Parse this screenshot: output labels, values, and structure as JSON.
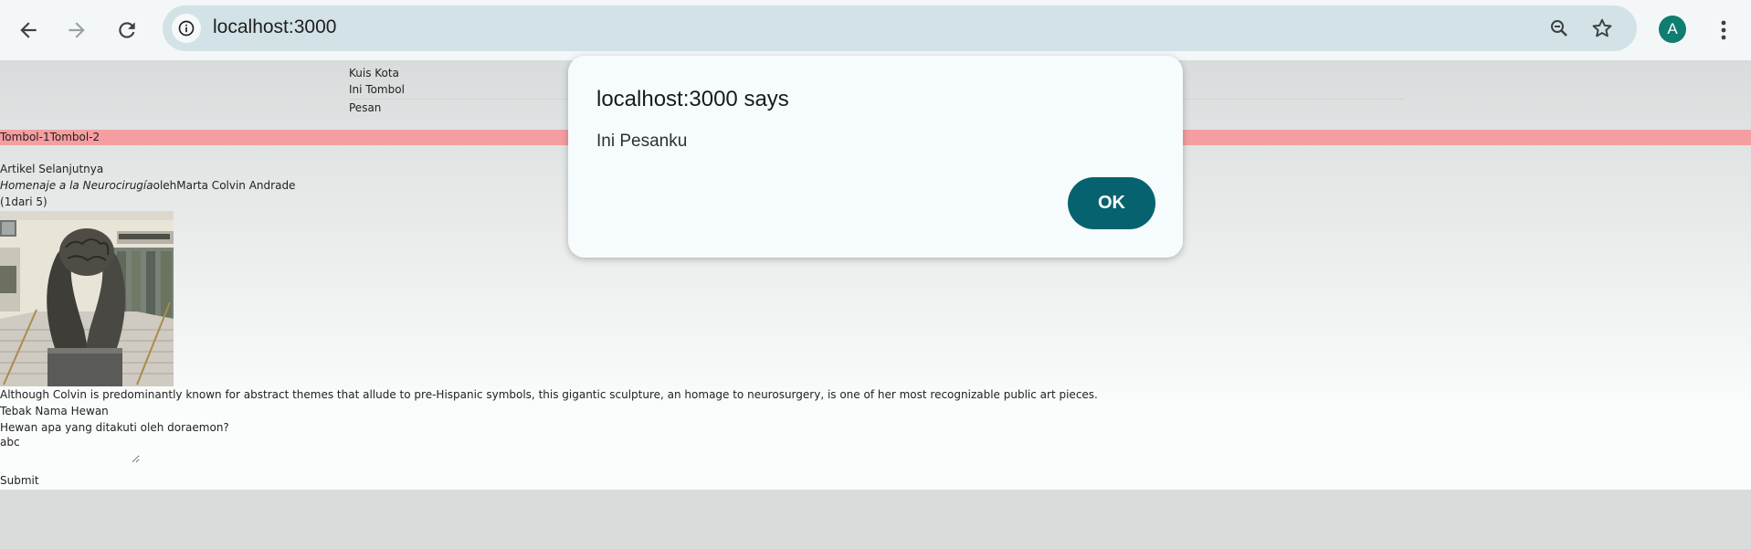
{
  "browser": {
    "url": "localhost:3000",
    "avatar_letter": "A",
    "icons": {
      "back": "arrow-left-icon",
      "forward": "arrow-right-icon",
      "reload": "reload-icon",
      "site_info": "info-icon",
      "zoom": "zoom-out-icon",
      "bookmark": "star-icon",
      "menu": "kebab-menu-icon"
    }
  },
  "page": {
    "nav": [
      "Kuis Kota",
      "Ini Tombol",
      "Pesan"
    ],
    "buttons": {
      "first": "Tombol-1",
      "second": "Tombol-2",
      "strip_color": "#f59ea1"
    },
    "article": {
      "heading": "Artikel Selanjutnya",
      "title": "Homenaje a la Neurocirugía",
      "by": "oleh",
      "author": "Marta Colvin Andrade",
      "counter_open": "(",
      "counter_index": "1",
      "counter_of": "dari",
      "counter_total": "5",
      "counter_close": ")",
      "description": "Although Colvin is predominantly known for abstract themes that allude to pre-Hispanic symbols, this gigantic sculpture, an homage to neurosurgery, is one of her most recognizable public art pieces."
    },
    "quiz": {
      "heading": "Tebak Nama Hewan",
      "question": "Hewan apa yang ditakuti oleh doraemon?",
      "answer_value": "abc",
      "submit_label": "Submit"
    }
  },
  "dialog": {
    "title": "localhost:3000 says",
    "message": "Ini Pesanku",
    "ok_label": "OK",
    "accent_color": "#07626f"
  }
}
